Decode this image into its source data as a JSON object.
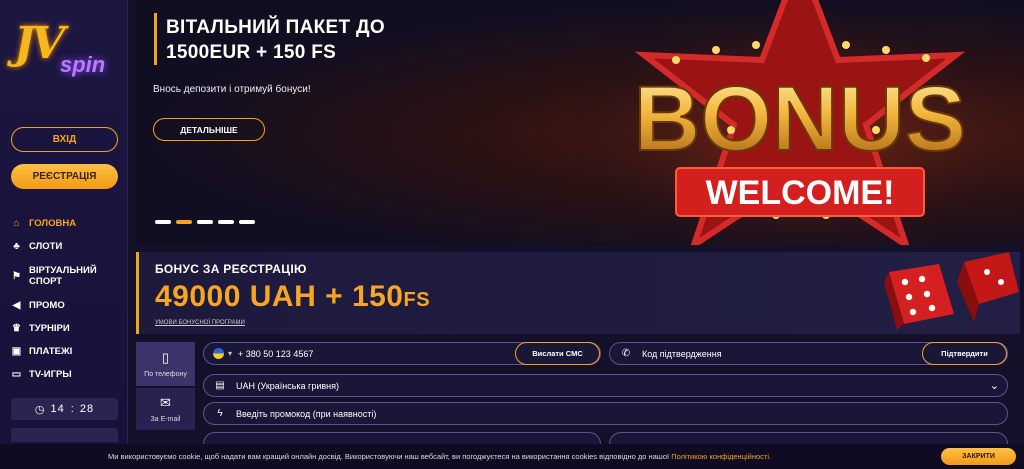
{
  "brand": {
    "logo_text_main": "JV",
    "logo_text_sub": "spin"
  },
  "sidebar": {
    "login_label": "ВХІД",
    "register_label": "РЕЄСТРАЦІЯ",
    "items": [
      {
        "label": "ГОЛОВНА",
        "icon": "home-icon",
        "active": true
      },
      {
        "label": "СЛОТИ",
        "icon": "cherries-icon"
      },
      {
        "label": "ВІРТУАЛЬНИЙ СПОРТ",
        "icon": "sport-icon"
      },
      {
        "label": "ПРОМО",
        "icon": "megaphone-icon"
      },
      {
        "label": "ТУРНІРИ",
        "icon": "trophy-icon"
      },
      {
        "label": "ПЛАТЕЖІ",
        "icon": "wallet-icon"
      },
      {
        "label": "TV-ИГРЫ",
        "icon": "tv-icon"
      }
    ],
    "clock": {
      "hours": "14",
      "separator": ":",
      "minutes": "28"
    }
  },
  "banner": {
    "title_line1": "ВІТАЛЬНИЙ ПАКЕТ ДО",
    "title_line2": "1500EUR + 150 FS",
    "subtitle": "Внось депозити і отримуй бонуси!",
    "details_label": "ДЕТАЛЬНІШЕ",
    "art_word1": "BONUS",
    "art_word2": "WELCOME!",
    "slides": 5,
    "active_slide": 2
  },
  "reg_bonus": {
    "label": "БОНУС ЗА РЕЄСТРАЦІЮ",
    "amount": "49000 UAH + 150",
    "amount_suffix": "FS",
    "terms_link": "УМОВИ БОНУСНОЇ ПРОГРАМИ"
  },
  "form": {
    "tabs": [
      {
        "label": "По телефону",
        "icon": "phone-icon",
        "active": true
      },
      {
        "label": "За E-mail",
        "icon": "mail-icon"
      }
    ],
    "phone_value": "+ 380 50 123 4567",
    "send_sms_label": "Вислати СМС",
    "code_placeholder": "Код підтвердження",
    "confirm_label": "Підтвердити",
    "currency_value": "UAH (Українська гривня)",
    "promo_placeholder": "Введіть промокод (при наявності)"
  },
  "cookie": {
    "text": "Ми використовуємо cookie, щоб надати вам кращий онлайн досвід. Використовуючи наш вебсайт, ви погоджуєтеся на використання cookies відповідно до нашої",
    "link": "Політикою конфіденційності.",
    "close_label": "ЗАКРИТИ"
  },
  "colors": {
    "accent": "#f4a321",
    "background": "#14102a",
    "panel": "#1d1a3c"
  }
}
